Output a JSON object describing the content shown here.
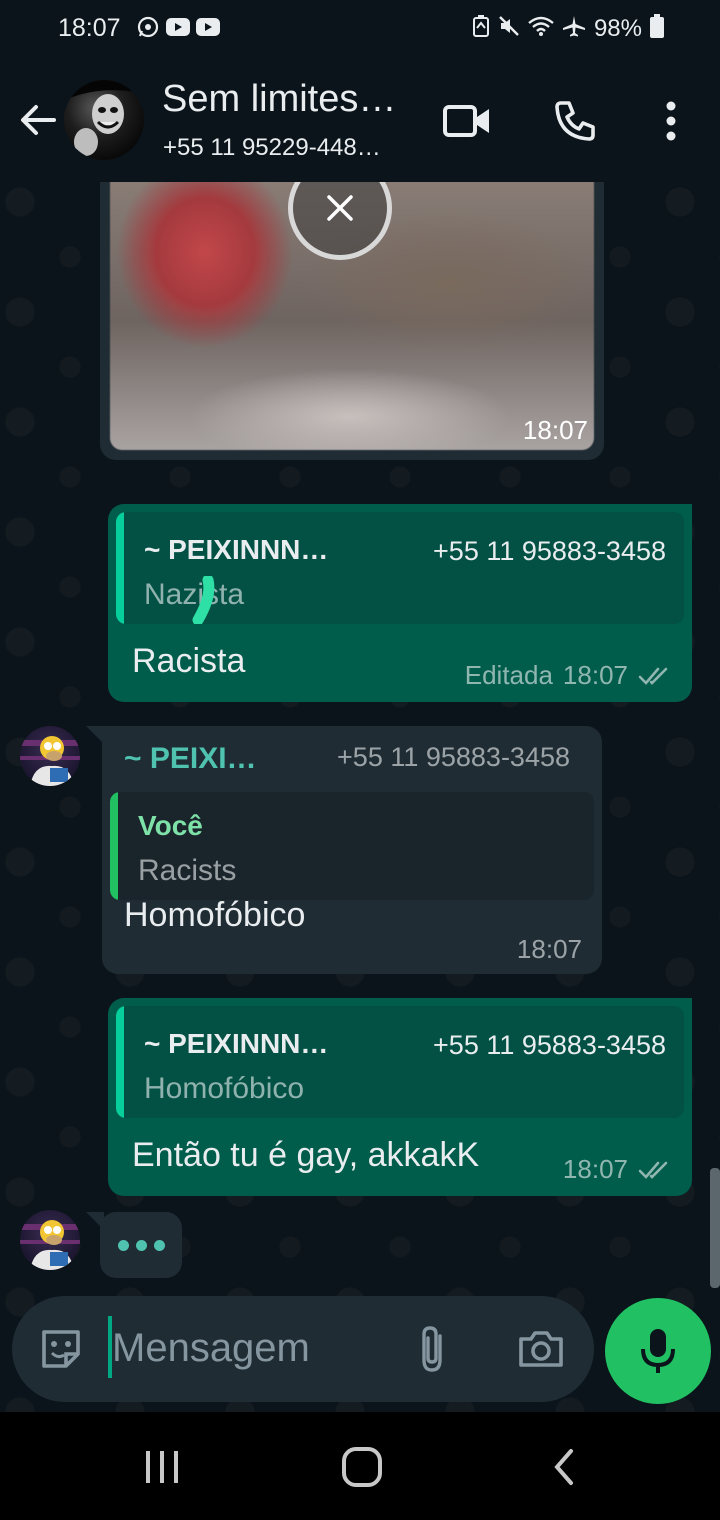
{
  "status_bar": {
    "time": "18:07",
    "left_icons": [
      "whatsapp-icon",
      "youtube-icon",
      "youtube-icon"
    ],
    "right_icons": [
      "data-saver-icon",
      "mute-icon",
      "wifi-icon",
      "airplane-icon"
    ],
    "battery": "98%"
  },
  "header": {
    "title": "Sem limites…",
    "subtitle": "+55 11 95229-448…",
    "actions": [
      "video-call-icon",
      "voice-call-icon",
      "more-options-icon"
    ]
  },
  "messages": [
    {
      "type": "image",
      "direction": "incoming",
      "time": "18:07",
      "status": "download-cancel"
    },
    {
      "direction": "outgoing",
      "quote": {
        "name": "~ PEIXINNN…",
        "phone": "+55 11 95883-3458",
        "text": "Nazista"
      },
      "text": "Racista",
      "edited_label": "Editada",
      "time": "18:07",
      "ticks": "double-check"
    },
    {
      "direction": "incoming",
      "sender_name": "~ PEIXI…",
      "sender_phone": "+55 11 95883-3458",
      "quote": {
        "name": "Você",
        "text": "Racists"
      },
      "text": "Homofóbico",
      "time": "18:07"
    },
    {
      "direction": "outgoing",
      "quote": {
        "name": "~ PEIXINNN…",
        "phone": "+55 11 95883-3458",
        "text": "Homofóbico"
      },
      "text": "Então tu é gay, akkakK",
      "time": "18:07",
      "ticks": "double-check"
    }
  ],
  "typing_indicator": "•••",
  "composer": {
    "placeholder": "Mensagem",
    "icons": [
      "sticker-icon",
      "attach-icon",
      "camera-icon",
      "mic-icon"
    ]
  },
  "colors": {
    "background": "#0b141a",
    "outgoing_bubble": "#005c4b",
    "incoming_bubble": "#1f2c34",
    "accent_green": "#21c063",
    "quote_bar_teal": "#06cf9c",
    "sender_name_teal": "#53bdeb"
  }
}
